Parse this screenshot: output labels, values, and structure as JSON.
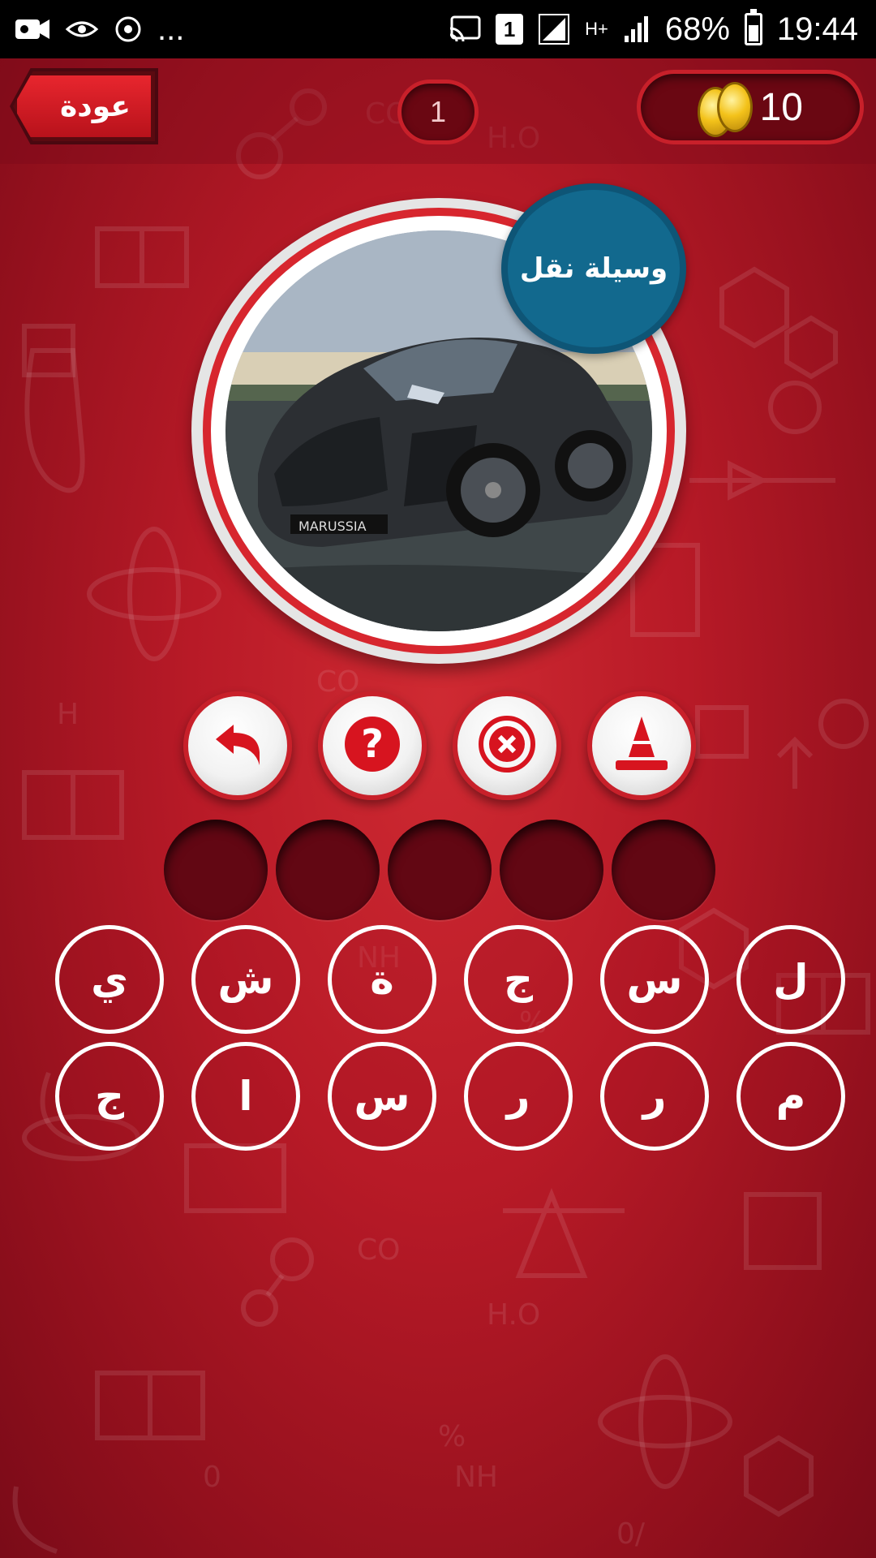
{
  "status_bar": {
    "left_icons": [
      "video-call-icon",
      "eye-comfort-icon",
      "sync-icon"
    ],
    "overflow": "...",
    "sim_badge": "1",
    "network": "H+",
    "battery": "68%",
    "time": "19:44"
  },
  "header": {
    "back_label": "عودة",
    "level": "1",
    "coins": "10"
  },
  "question": {
    "category": "وسيلة نقل",
    "image_icon": "sports-car-photo"
  },
  "helpers": [
    {
      "icon": "undo-arrow-icon"
    },
    {
      "icon": "question-mark-icon"
    },
    {
      "icon": "remove-letters-icon"
    },
    {
      "icon": "traffic-cone-icon"
    }
  ],
  "answer_slots": 5,
  "letters": {
    "row1": [
      "ي",
      "ش",
      "ة",
      "ج",
      "س",
      "ل"
    ],
    "row2": [
      "ج",
      "ا",
      "س",
      "ر",
      "ر",
      "م"
    ]
  },
  "colors": {
    "background": "#b81a27",
    "badge": "#12698e",
    "accent": "#c8202a"
  }
}
